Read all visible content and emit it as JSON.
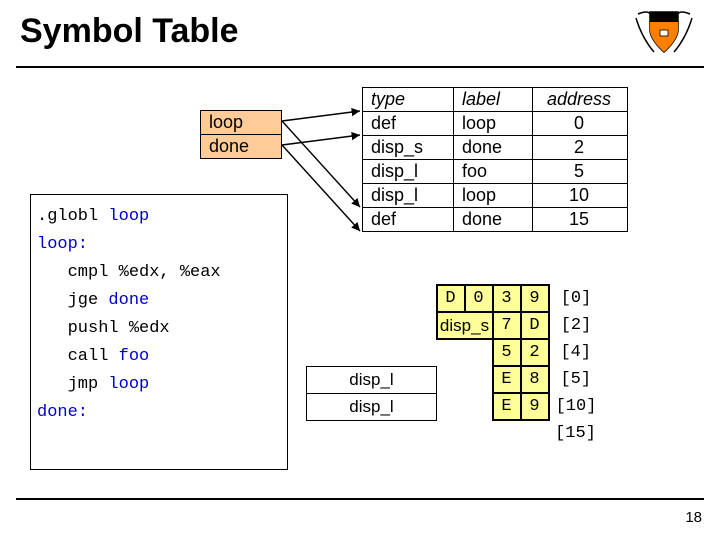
{
  "title": "Symbol Table",
  "page_number": "18",
  "ld_box": {
    "r0": "loop",
    "r1": "done"
  },
  "sym": {
    "h0": "type",
    "h1": "label",
    "h2": "address",
    "r0c0": "def",
    "r0c1": "loop",
    "r0c2": "0",
    "r1c0": "disp_s",
    "r1c1": "done",
    "r1c2": "2",
    "r2c0": "disp_l",
    "r2c1": "foo",
    "r2c2": "5",
    "r3c0": "disp_l",
    "r3c1": "loop",
    "r3c2": "10",
    "r4c0": "def",
    "r4c1": "done",
    "r4c2": "15"
  },
  "code": {
    "l0a": ".globl ",
    "l0b": "loop",
    "l1": "loop:",
    "l2": "   cmpl %edx, %eax",
    "l3a": "   jge ",
    "l3b": "done",
    "l4": "   pushl %edx",
    "l5a": "   call ",
    "l5b": "foo",
    "l6a": "   jmp ",
    "l6b": "loop",
    "l7": "done:"
  },
  "enc": {
    "r0_disp": "",
    "r0_b0": "D",
    "r0_b1": "0",
    "r0_b2": "3",
    "r0_b3": "9",
    "r0_note": "[0]",
    "r1_disp": "disp_s",
    "r1_b2": "7",
    "r1_b3": "D",
    "r1_note": "[2]",
    "r2_b2": "5",
    "r2_b3": "2",
    "r2_note": "[4]",
    "r3_disp": "disp_l",
    "r3_b2": "E",
    "r3_b3": "8",
    "r3_note": "[5]",
    "r4_disp": "disp_l",
    "r4_b2": "E",
    "r4_b3": "9",
    "r4_note": "[10]",
    "r5_note": "[15]"
  }
}
